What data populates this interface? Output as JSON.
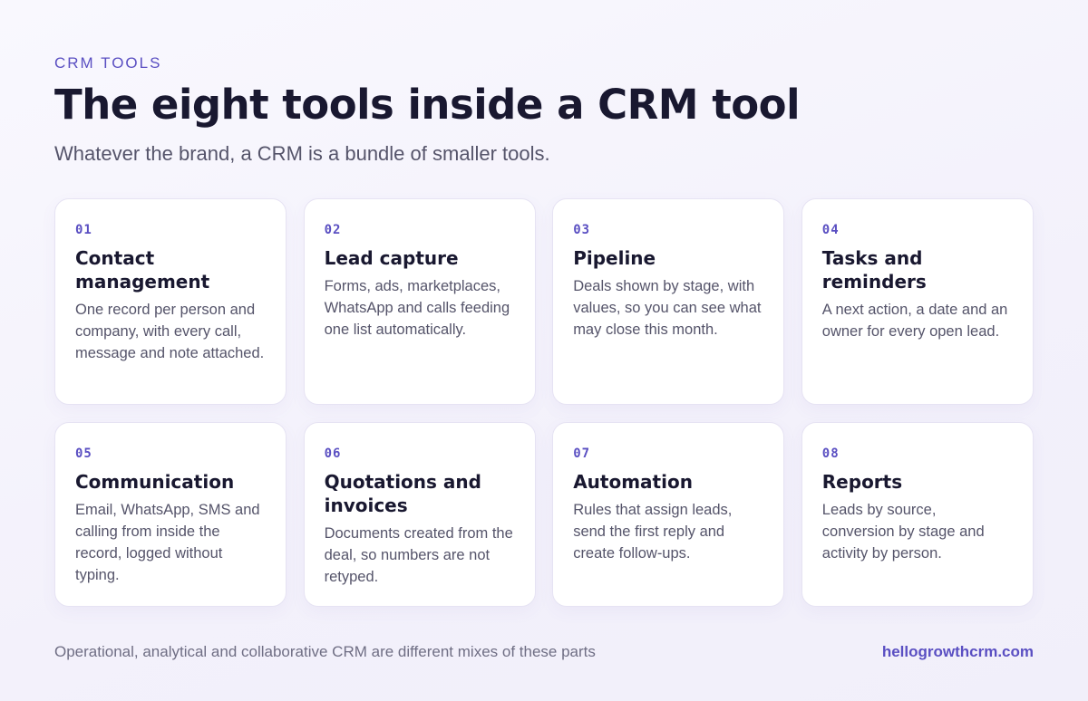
{
  "header": {
    "eyebrow": "CRM TOOLS",
    "title": "The eight tools inside a CRM tool",
    "subtitle": "Whatever the brand, a CRM is a bundle of smaller tools."
  },
  "cards": [
    {
      "number": "01",
      "title": "Contact management",
      "body": "One record per person and company, with every call, message and note attached."
    },
    {
      "number": "02",
      "title": "Lead capture",
      "body": "Forms, ads, marketplaces, WhatsApp and calls feeding one list automatically."
    },
    {
      "number": "03",
      "title": "Pipeline",
      "body": "Deals shown by stage, with values, so you can see what may close this month."
    },
    {
      "number": "04",
      "title": "Tasks and reminders",
      "body": "A next action, a date and an owner for every open lead."
    },
    {
      "number": "05",
      "title": "Communication",
      "body": "Email, WhatsApp, SMS and calling from inside the record, logged without typing."
    },
    {
      "number": "06",
      "title": "Quotations and invoices",
      "body": "Documents created from the deal, so numbers are not retyped."
    },
    {
      "number": "07",
      "title": "Automation",
      "body": "Rules that assign leads, send the first reply and create follow-ups."
    },
    {
      "number": "08",
      "title": "Reports",
      "body": "Leads by source, conversion by stage and activity by person."
    }
  ],
  "footer": {
    "note": "Operational, analytical and collaborative CRM are different mixes of these parts",
    "link": "hellogrowthcrm.com"
  },
  "colors": {
    "accent": "#5a4fc2",
    "title": "#191830",
    "body_text": "#55546a",
    "card_border": "#e6e3f3"
  }
}
